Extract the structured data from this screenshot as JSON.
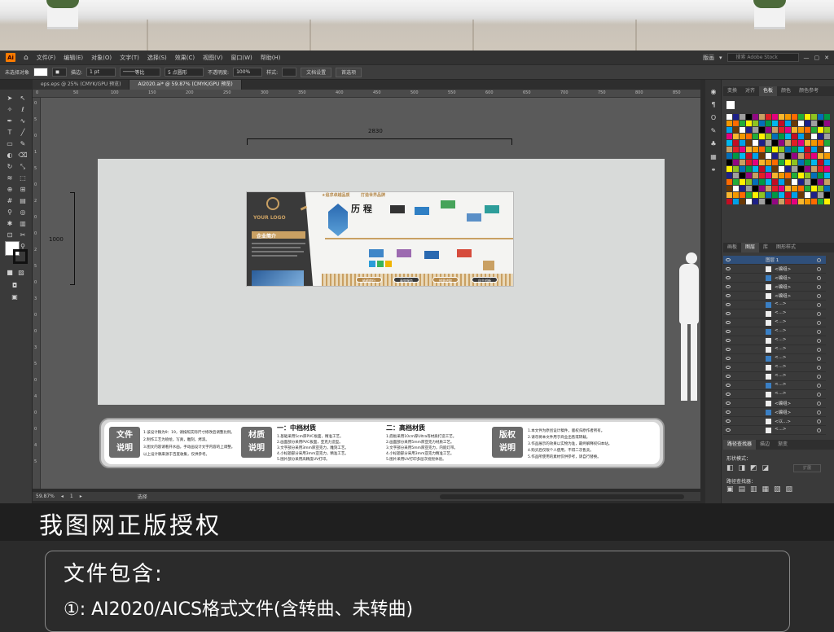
{
  "menubar": {
    "items": [
      "文件(F)",
      "编辑(E)",
      "对象(O)",
      "文字(T)",
      "选择(S)",
      "效果(C)",
      "视图(V)",
      "窗口(W)",
      "帮助(H)"
    ],
    "workspace": "版画",
    "search_placeholder": "搜索 Adobe Stock"
  },
  "control": {
    "no_selection": "未选择对象",
    "stroke_label": "描边:",
    "stroke_value": "1 pt",
    "stroke_type": "等比",
    "brush": "5 点圆形",
    "opacity_label": "不透明度:",
    "opacity_value": "100%",
    "style_label": "样式:",
    "doc_setup": "文档设置",
    "prefs": "首选项"
  },
  "tabs": [
    {
      "label": "eps.eps @ 25% (CMYK/GPU 预览)",
      "active": false
    },
    {
      "label": "AI2020.ai* @ 59.87% (CMYK/GPU 预览)",
      "active": true
    }
  ],
  "ruler": {
    "h": [
      "0",
      "50",
      "100",
      "150",
      "200",
      "250",
      "300",
      "350",
      "400",
      "450",
      "500",
      "550",
      "600",
      "650",
      "700",
      "750",
      "800",
      "850"
    ],
    "v": [
      "0",
      "5",
      "0",
      "1",
      "5",
      "0",
      "2",
      "0",
      "0",
      "2",
      "5",
      "0",
      "3",
      "0",
      "0",
      "3",
      "5",
      "0",
      "4",
      "0",
      "0",
      "4",
      "5"
    ]
  },
  "dimensions": {
    "width": "2830",
    "height": "1000"
  },
  "design": {
    "logo": "YOUR LOGO",
    "tagline1": "★追求卓越品质",
    "tagline2": "打造世界品牌",
    "intro": "企业简介",
    "history": "历 程",
    "badges": [
      "砥砺前行",
      "高效服务",
      "锐意进取",
      "自主创新"
    ]
  },
  "banner": {
    "heads": [
      "文件\n说明",
      "材质\n说明",
      "版权\n说明"
    ],
    "mid_title": "一：中档材质",
    "high_title": "二：高档材质",
    "file_lines": [
      "1.该设计稿为9：19，请按照实际尺寸修改后调整比例。",
      "2.制作工艺为喷绘，写真，雕刻，烤漆。",
      "3.图文内容请看开水画，手动画设计文字内容的上调整。",
      "   以上设计稿来源于百度收集，仅供参考。"
    ],
    "mid_lines": [
      "1.基础采用5cm厚PVC板面，精准工艺。",
      "2.画面部分采用PVC板面，亚克力造型。",
      "3.文字部分采用3mm厚亚克力，雕刻工艺。",
      "4.小标题部分采用3mm亚克力，精准工艺。",
      "5.图片部分采用高精度UV打印。"
    ],
    "high_lines": [
      "1.底板采用10cm厚Ultra等材质打造工艺。",
      "2.画面部分采用5mm厚亚克力材质工艺。",
      "3.文字部分采用5mm厚亚克力，内嵌灯带。",
      "4.小标题部分采用3mm亚克力精准工艺。",
      "5.图片采用UV打印多层次视觉体验。"
    ],
    "copy_lines": [
      "1.本文件为原创设计稿件，版权归原作者所有。",
      "2.请勿将本文件用于商业出售或转载。",
      "3.作品展示的效果以实物为准，最终解释权归本站。",
      "4.购买后仅限个人使用，不得二次售卖。",
      "5.作品所使用的素材仅供参考，请自行替换。"
    ]
  },
  "status": {
    "zoom": "59.87%",
    "artboard": "1",
    "mode": "选择"
  },
  "right_panel": {
    "color_tabs": [
      "变换",
      "对齐",
      "色板",
      "颜色",
      "颜色参考"
    ],
    "layer_tabs": [
      "画板",
      "图层",
      "库",
      "图形样式"
    ],
    "layer_top": "图层 1",
    "layer_items": [
      "<编组>",
      "<编组>",
      "<编组>",
      "<编组>",
      "<...>",
      "<...>",
      "<...>",
      "<...>",
      "<...>",
      "<...>",
      "<...>",
      "<...>",
      "<...>",
      "<...>",
      "<...>",
      "<编组>",
      "<编组>",
      "<以...>",
      "<...>"
    ],
    "bottom_tabs": [
      "路径查找器",
      "描边",
      "渐变"
    ],
    "shape_modes": "形状模式：",
    "expand": "扩展",
    "pathfinder": "路径查找器："
  },
  "swatch_colors": [
    "#ffffff",
    "#000000",
    "#e31e24",
    "#f39800",
    "#fff100",
    "#009944",
    "#00a0e9",
    "#1d2088",
    "#920783",
    "#e4007f",
    "#ff6a00",
    "#8fc31f",
    "#00b7ee",
    "#6a3906",
    "#a0a0a0",
    "#c9a063",
    "#f8b62d",
    "#22ac38",
    "#036eb8",
    "#c30d23"
  ],
  "promo": {
    "title": "我图网正版授权",
    "subtitle": "文件包含:",
    "item": "①: AI2020/AICS格式文件(含转曲、未转曲)"
  }
}
